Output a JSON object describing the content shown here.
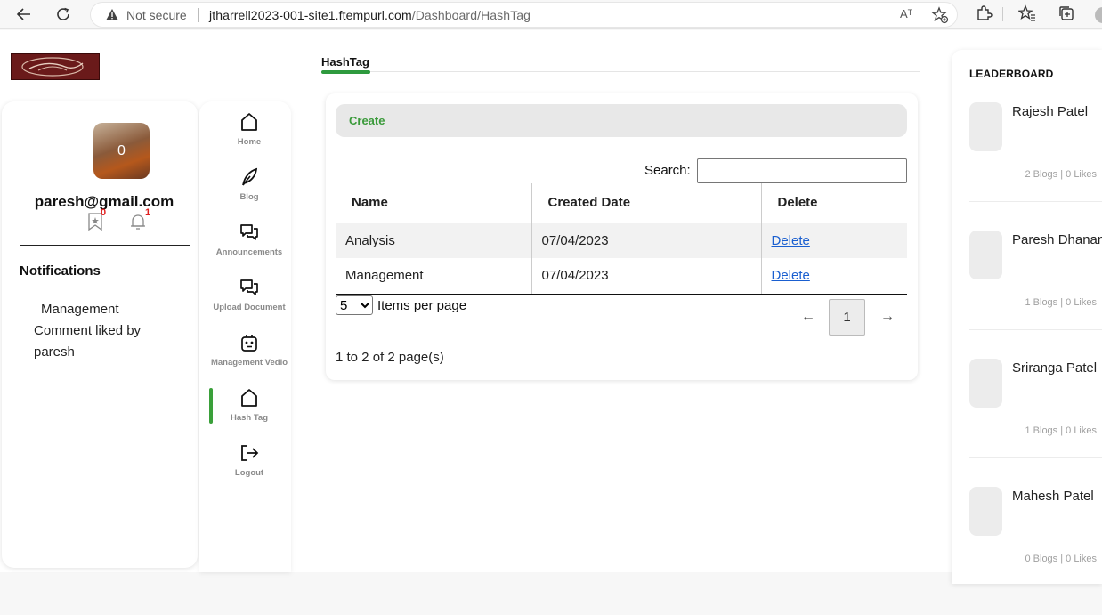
{
  "browser": {
    "not_secure": "Not secure",
    "url_host": "jtharrell2023-001-site1.ftempurl.com",
    "url_path": "/Dashboard/HashTag",
    "read_aloud": "Aᵀ"
  },
  "profile": {
    "avatar_count": "0",
    "email": "paresh@gmail.com",
    "star_count": "0",
    "bell_count": "1",
    "notifications_title": "Notifications",
    "notification_line1": "Management",
    "notification_line2": "Comment liked by paresh"
  },
  "nav": {
    "home": "Home",
    "blog": "Blog",
    "announcements": "Announcements",
    "upload": "Upload Document",
    "vedio": "Management Vedio",
    "hashtag": "Hash Tag",
    "logout": "Logout"
  },
  "main": {
    "tab": "HashTag",
    "create": "Create",
    "search_label": "Search:",
    "columns": [
      "Name",
      "Created Date",
      "Delete"
    ],
    "rows": [
      {
        "name": "Analysis",
        "date": "07/04/2023",
        "action": "Delete"
      },
      {
        "name": "Management",
        "date": "07/04/2023",
        "action": "Delete"
      }
    ],
    "page_size": "5",
    "page_size_label": "Items per page",
    "current_page": "1",
    "prev": "←",
    "next": "→",
    "page_info": "1 to 2 of 2 page(s)"
  },
  "leaderboard": {
    "title": "LEADERBOARD",
    "entries": [
      {
        "name": "Rajesh Patel",
        "stats": "2 Blogs | 0 Likes"
      },
      {
        "name": "Paresh Dhanani",
        "stats": "1 Blogs | 0 Likes"
      },
      {
        "name": "Sriranga Patel",
        "stats": "1 Blogs | 0 Likes"
      },
      {
        "name": "Mahesh Patel",
        "stats": "0 Blogs | 0 Likes"
      }
    ]
  },
  "colors": {
    "accent_green": "#3a9a3a",
    "link_blue": "#1a5fd0",
    "badge_red": "#e02020",
    "logo_maroon": "#6a1a1a"
  }
}
